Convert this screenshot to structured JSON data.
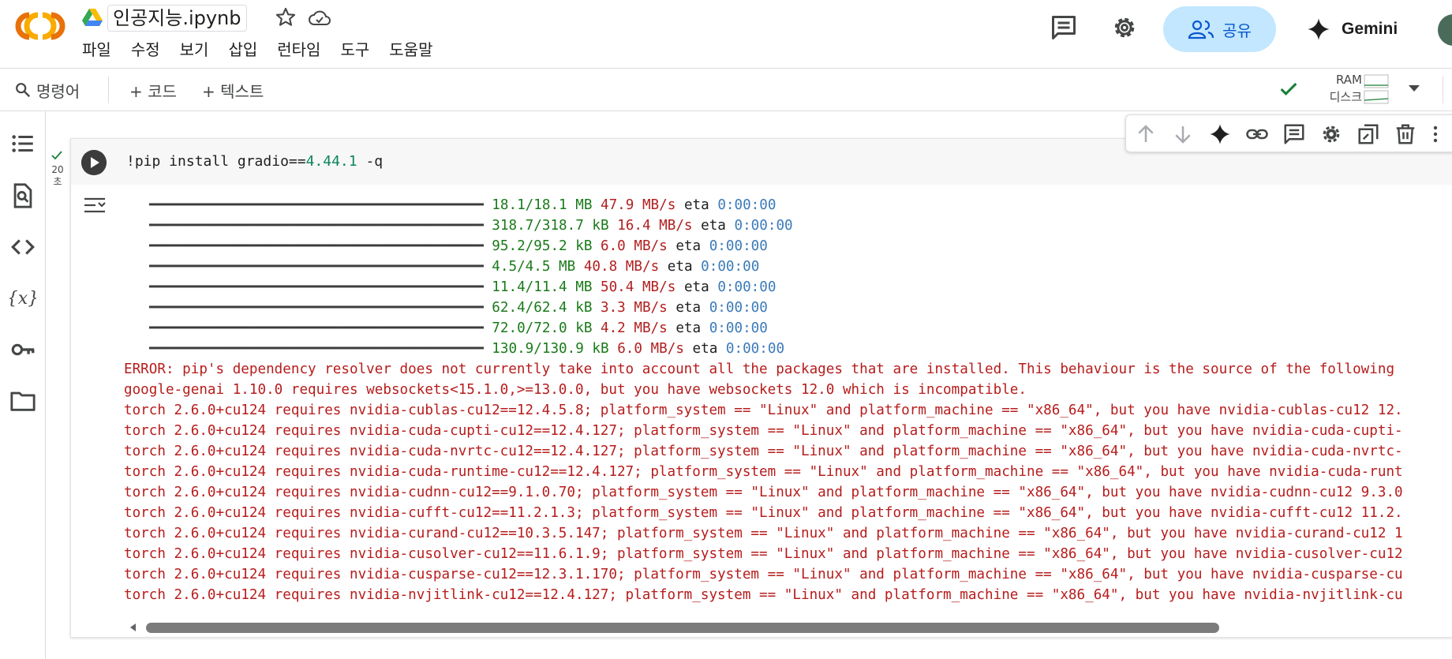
{
  "header": {
    "notebook_title": "인공지능.ipynb",
    "menu": [
      "파일",
      "수정",
      "보기",
      "삽입",
      "런타임",
      "도구",
      "도움말"
    ],
    "share_label": "공유",
    "gemini_label": "Gemini"
  },
  "toolbar": {
    "command_label": "명령어",
    "add_code_label": "+ 코드",
    "add_text_label": "+ 텍스트",
    "ram_label": "RAM",
    "disk_label": "디스크"
  },
  "cell": {
    "exec_time": "20\n초",
    "code_prefix": "!pip install gradio==",
    "code_version": "4.44.1",
    "code_suffix": " -q",
    "progress_bar": "━━━━━━━━━━━━━━━━━━━━━━━━━━━━━━━━━━━━━━━━",
    "progress": [
      {
        "size": "18.1/18.1 MB",
        "speed": "47.9 MB/s",
        "eta_label": "eta",
        "eta": "0:00:00"
      },
      {
        "size": "318.7/318.7 kB",
        "speed": "16.4 MB/s",
        "eta_label": "eta",
        "eta": "0:00:00"
      },
      {
        "size": "95.2/95.2 kB",
        "speed": "6.0 MB/s",
        "eta_label": "eta",
        "eta": "0:00:00"
      },
      {
        "size": "4.5/4.5 MB",
        "speed": "40.8 MB/s",
        "eta_label": "eta",
        "eta": "0:00:00"
      },
      {
        "size": "11.4/11.4 MB",
        "speed": "50.4 MB/s",
        "eta_label": "eta",
        "eta": "0:00:00"
      },
      {
        "size": "62.4/62.4 kB",
        "speed": "3.3 MB/s",
        "eta_label": "eta",
        "eta": "0:00:00"
      },
      {
        "size": "72.0/72.0 kB",
        "speed": "4.2 MB/s",
        "eta_label": "eta",
        "eta": "0:00:00"
      },
      {
        "size": "130.9/130.9 kB",
        "speed": "6.0 MB/s",
        "eta_label": "eta",
        "eta": "0:00:00"
      }
    ],
    "errors": [
      "ERROR: pip's dependency resolver does not currently take into account all the packages that are installed. This behaviour is the source of the following",
      "google-genai 1.10.0 requires websockets<15.1.0,>=13.0.0, but you have websockets 12.0 which is incompatible.",
      "torch 2.6.0+cu124 requires nvidia-cublas-cu12==12.4.5.8; platform_system == \"Linux\" and platform_machine == \"x86_64\", but you have nvidia-cublas-cu12 12.",
      "torch 2.6.0+cu124 requires nvidia-cuda-cupti-cu12==12.4.127; platform_system == \"Linux\" and platform_machine == \"x86_64\", but you have nvidia-cuda-cupti-",
      "torch 2.6.0+cu124 requires nvidia-cuda-nvrtc-cu12==12.4.127; platform_system == \"Linux\" and platform_machine == \"x86_64\", but you have nvidia-cuda-nvrtc-",
      "torch 2.6.0+cu124 requires nvidia-cuda-runtime-cu12==12.4.127; platform_system == \"Linux\" and platform_machine == \"x86_64\", but you have nvidia-cuda-runt",
      "torch 2.6.0+cu124 requires nvidia-cudnn-cu12==9.1.0.70; platform_system == \"Linux\" and platform_machine == \"x86_64\", but you have nvidia-cudnn-cu12 9.3.0",
      "torch 2.6.0+cu124 requires nvidia-cufft-cu12==11.2.1.3; platform_system == \"Linux\" and platform_machine == \"x86_64\", but you have nvidia-cufft-cu12 11.2.",
      "torch 2.6.0+cu124 requires nvidia-curand-cu12==10.3.5.147; platform_system == \"Linux\" and platform_machine == \"x86_64\", but you have nvidia-curand-cu12 1",
      "torch 2.6.0+cu124 requires nvidia-cusolver-cu12==11.6.1.9; platform_system == \"Linux\" and platform_machine == \"x86_64\", but you have nvidia-cusolver-cu12",
      "torch 2.6.0+cu124 requires nvidia-cusparse-cu12==12.3.1.170; platform_system == \"Linux\" and platform_machine == \"x86_64\", but you have nvidia-cusparse-cu",
      "torch 2.6.0+cu124 requires nvidia-nvjitlink-cu12==12.4.127; platform_system == \"Linux\" and platform_machine == \"x86_64\", but you have nvidia-nvjitlink-cu"
    ]
  },
  "icons": {
    "rail": [
      "table-of-contents-icon",
      "find-replace-icon",
      "code-snippets-icon",
      "variables-icon",
      "secrets-key-icon",
      "files-folder-icon"
    ],
    "cell_toolbar": [
      "move-up-icon",
      "move-down-icon",
      "gemini-sparkle-icon",
      "link-icon",
      "comment-icon",
      "settings-icon",
      "mirror-cell-icon",
      "delete-icon",
      "more-vert-icon"
    ]
  },
  "colors": {
    "accent": "#0b57d0",
    "share_bg": "#c2e7ff",
    "success": "#188038",
    "error_text": "#b71c1c",
    "size_text": "#1a7a1a",
    "eta_text": "#3b7ab8"
  }
}
